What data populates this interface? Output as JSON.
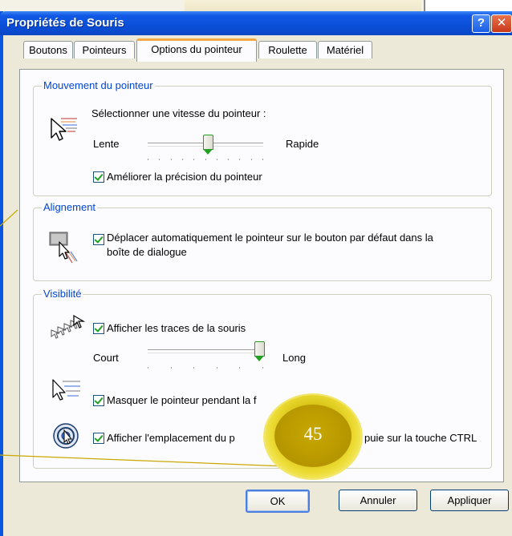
{
  "window": {
    "title": "Propriétés de Souris",
    "help_glyph": "?",
    "close_glyph": "✕"
  },
  "tabs": [
    {
      "label": "Boutons",
      "active": false
    },
    {
      "label": "Pointeurs",
      "active": false
    },
    {
      "label": "Options du pointeur",
      "active": true
    },
    {
      "label": "Roulette",
      "active": false
    },
    {
      "label": "Matériel",
      "active": false
    }
  ],
  "motion": {
    "legend": "Mouvement du pointeur",
    "prompt": "Sélectionner une vitesse du pointeur :",
    "slow_label": "Lente",
    "fast_label": "Rapide",
    "speed_level": 0.52,
    "precision_label": "Améliorer la précision du pointeur",
    "precision_checked": true,
    "icon": "pointer-speed-icon"
  },
  "snap": {
    "legend": "Alignement",
    "label_line1": "Déplacer automatiquement le pointeur sur le bouton par défaut dans la",
    "label_line2": "boîte de dialogue",
    "checked": true,
    "icon": "snap-to-button-icon"
  },
  "visibility": {
    "legend": "Visibilité",
    "trails_label": "Afficher les traces de la souris",
    "trails_checked": true,
    "short_label": "Court",
    "long_label": "Long",
    "trails_level": 1.0,
    "hide_label": "Masquer le pointeur pendant la f",
    "hide_checked": true,
    "ctrl_label_start": "Afficher l'emplacement du p",
    "ctrl_label_end": "puie sur la touche CTRL",
    "ctrl_checked": true,
    "icons": [
      "pointer-trails-icon",
      "hide-pointer-icon",
      "ctrl-locate-icon"
    ]
  },
  "buttons": {
    "ok": "OK",
    "cancel": "Annuler",
    "apply": "Appliquer"
  },
  "callout": {
    "number": "45",
    "color": "#d6c112"
  },
  "colors": {
    "title_bar": "#0a4fd8",
    "legend_text": "#0046d5",
    "check": "#21a121",
    "active_tab_accent": "#f5a742"
  }
}
